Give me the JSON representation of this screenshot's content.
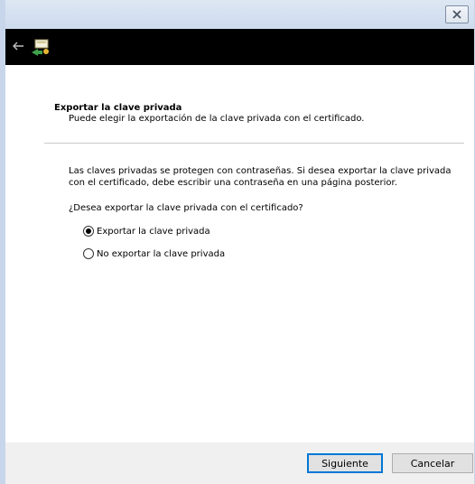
{
  "titlebar": {
    "close_icon": "close-icon"
  },
  "nav": {
    "back_icon": "back-arrow-icon",
    "wizard_icon": "certificate-export-wizard-icon"
  },
  "page": {
    "heading": "Exportar la clave privada",
    "subheading": "Puede elegir la exportación de la clave privada con el certificado.",
    "paragraph_line1": "Las claves privadas se protegen con contraseñas. Si desea exportar la clave privada",
    "paragraph_line2": "con el certificado, debe escribir una contraseña en una página posterior.",
    "question": "¿Desea exportar la clave privada con el certificado?",
    "options": [
      {
        "label": "Exportar la clave privada",
        "selected": true
      },
      {
        "label": "No exportar la clave privada",
        "selected": false
      }
    ]
  },
  "footer": {
    "next_label": "Siguiente",
    "cancel_label": "Cancelar"
  },
  "colors": {
    "titlebar": "#cddbee",
    "header_bar": "#000000",
    "footer": "#f0f0f0",
    "default_button_border": "#0078d7"
  }
}
